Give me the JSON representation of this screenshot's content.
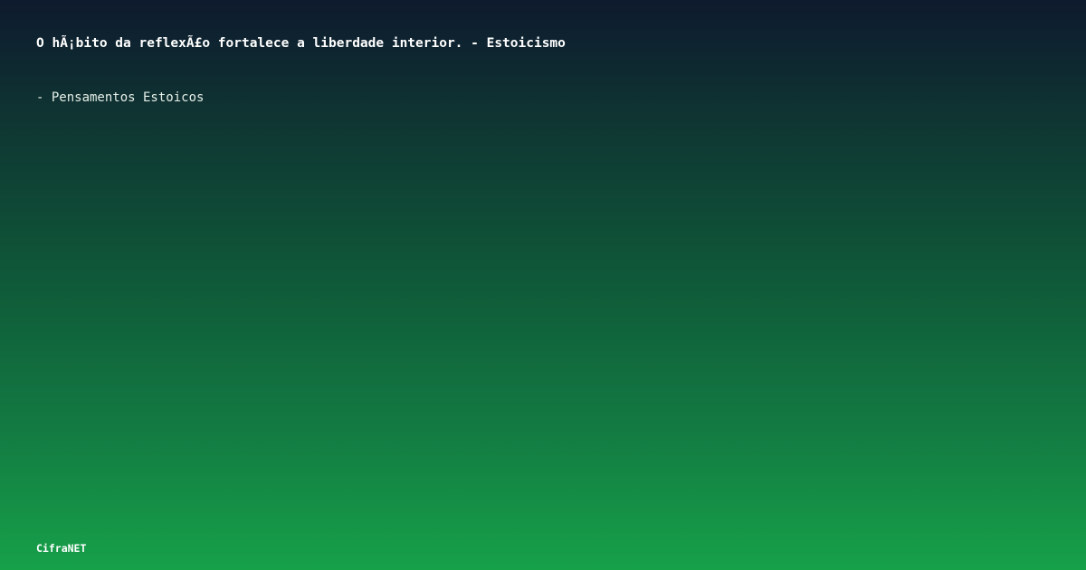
{
  "card": {
    "quote": "O hÃ¡bito da reflexÃ£o fortalece a liberdade interior. - Estoicismo",
    "attribution": "- Pensamentos Estoicos",
    "brand": "CifraNET"
  },
  "colors": {
    "gradient_top": "#0e1a2e",
    "gradient_bottom": "#16a149",
    "text": "#ffffff"
  }
}
